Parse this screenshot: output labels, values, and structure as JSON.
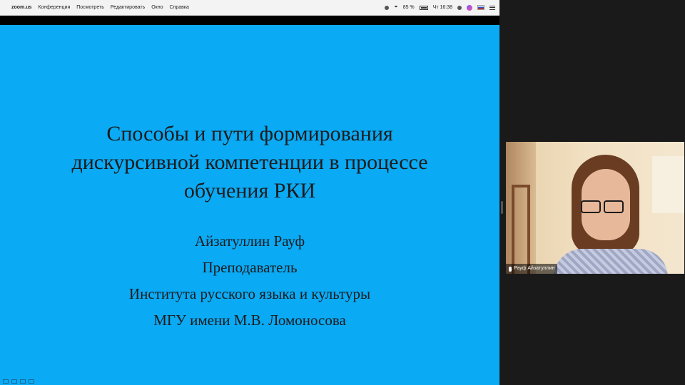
{
  "menubar": {
    "app_name": "zoom.us",
    "menus": [
      "Конференция",
      "Посмотреть",
      "Редактировать",
      "Окно",
      "Справка"
    ],
    "battery": "85 %",
    "clock": "Чт 16:38"
  },
  "slide": {
    "title_lines": [
      "Способы и пути формирования",
      "дискурсивной компетенции в процессе",
      "обучения РКИ"
    ],
    "info_lines": [
      "Айзатуллин Рауф",
      "Преподаватель",
      "Института русского языка и культуры",
      "МГУ имени М.В. Ломоносова"
    ],
    "background_color": "#0aaaf5"
  },
  "participant": {
    "name": "Рауф Айзатуллин"
  }
}
